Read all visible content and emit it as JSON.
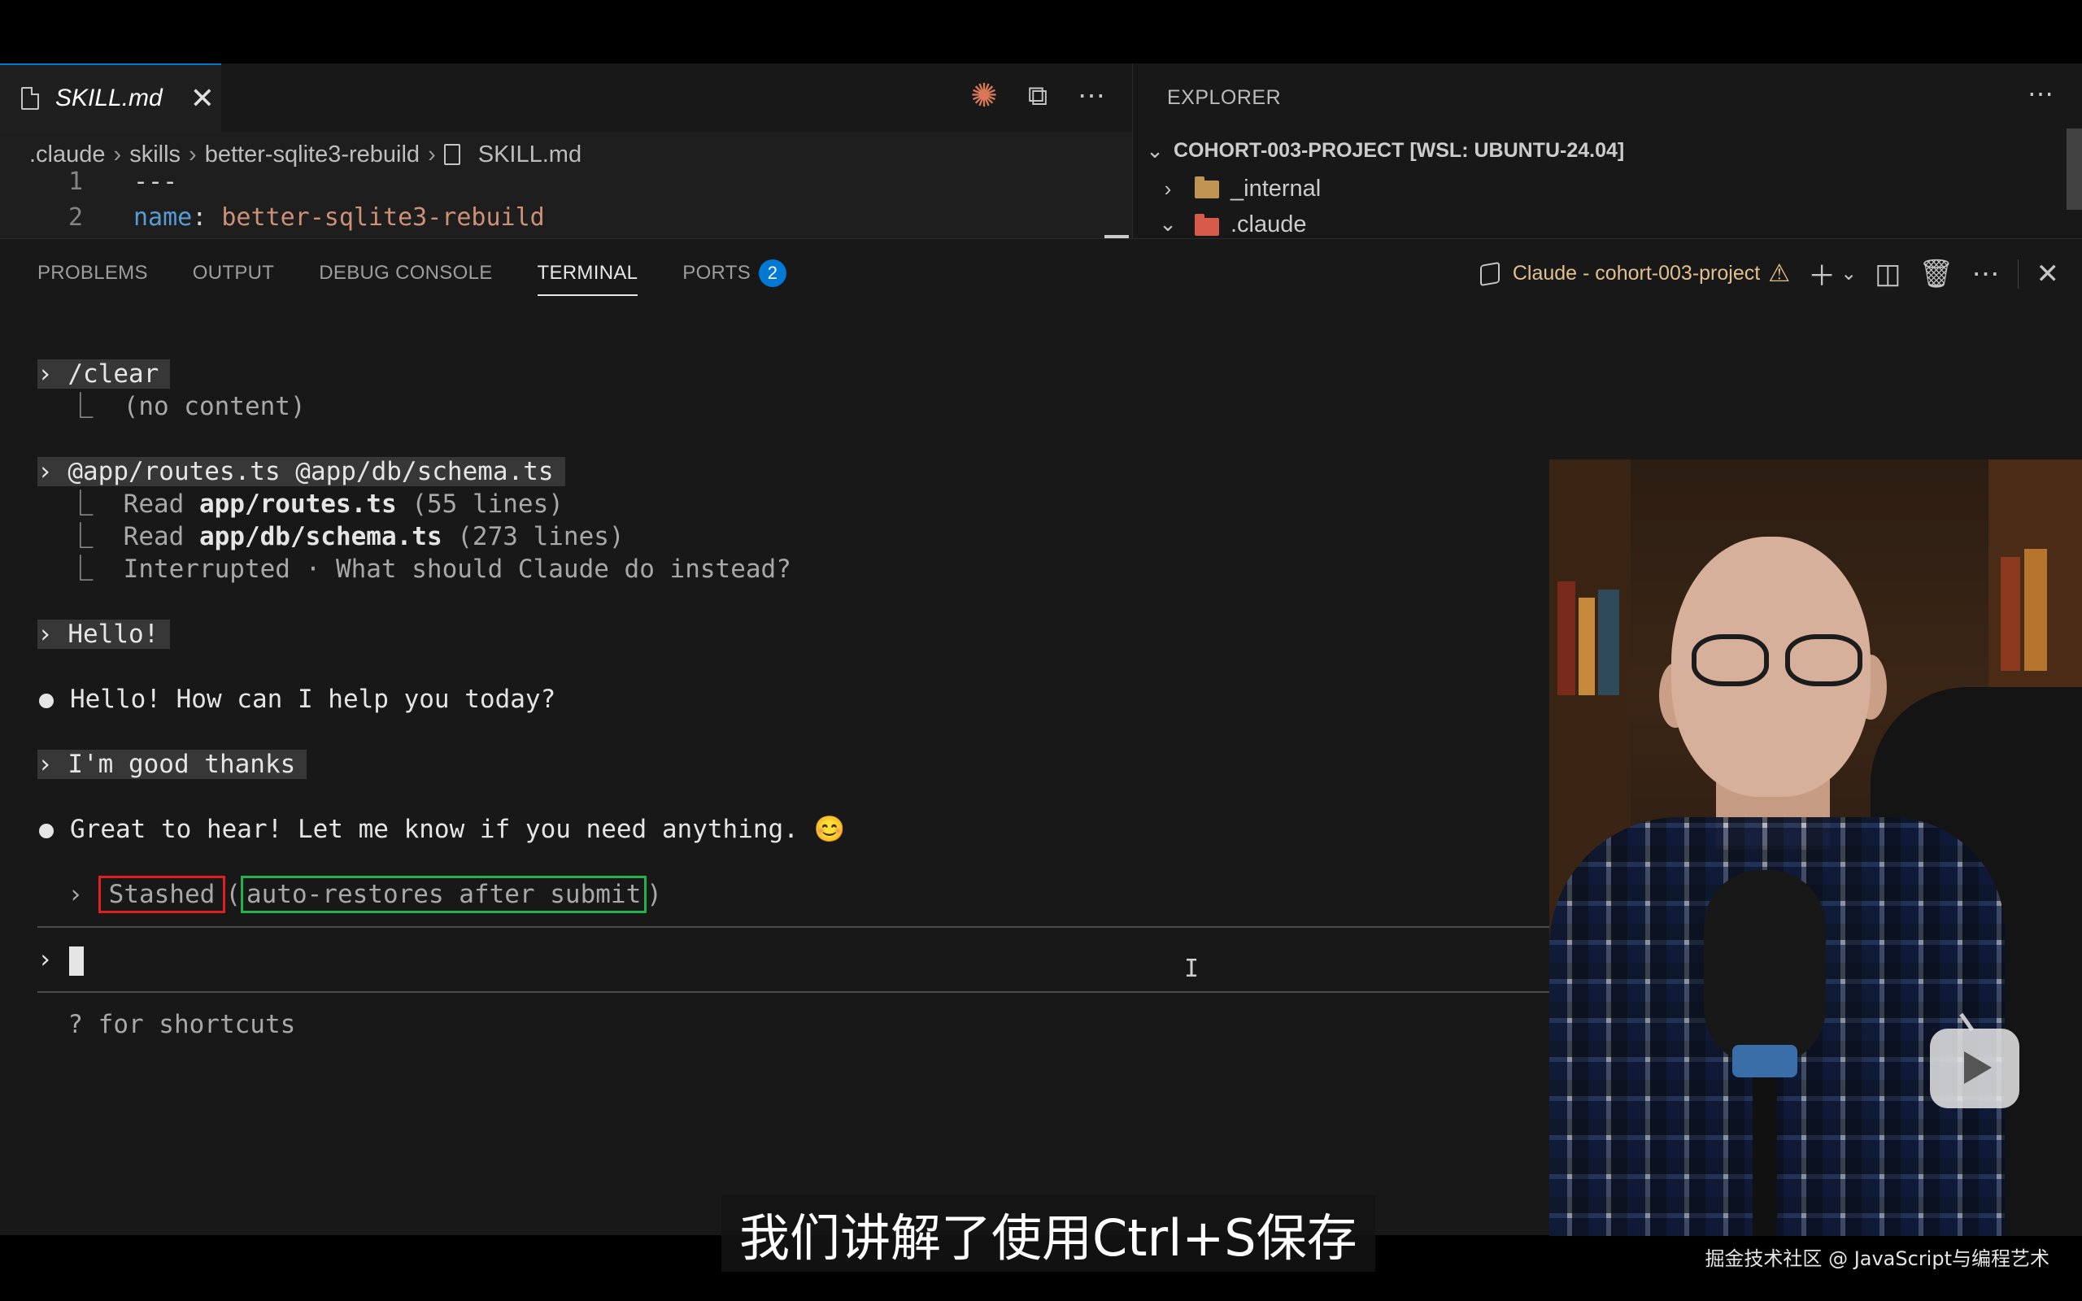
{
  "editor": {
    "tab_label": "SKILL.md",
    "tab_close": "✕",
    "breadcrumb": [
      ".claude",
      "skills",
      "better-sqlite3-rebuild",
      "SKILL.md"
    ],
    "lines": [
      {
        "num": "1",
        "text": "---"
      },
      {
        "num": "2",
        "key": "name",
        "colon": ": ",
        "value": "better-sqlite3-rebuild"
      }
    ]
  },
  "explorer": {
    "title": "EXPLORER",
    "root": "COHORT-003-PROJECT [WSL: UBUNTU-24.04]",
    "items": [
      {
        "label": "_internal",
        "expanded": false
      },
      {
        "label": ".claude",
        "expanded": true
      }
    ]
  },
  "panel": {
    "tabs": [
      {
        "label": "PROBLEMS"
      },
      {
        "label": "OUTPUT"
      },
      {
        "label": "DEBUG CONSOLE"
      },
      {
        "label": "TERMINAL",
        "active": true
      },
      {
        "label": "PORTS",
        "badge": "2"
      }
    ],
    "terminal_name": "Claude - cohort-003-project"
  },
  "terminal": {
    "cmd1": "/clear",
    "cmd1_out": "(no content)",
    "cmd2": "@app/routes.ts @app/db/schema.ts",
    "read1_prefix": "Read ",
    "read1_file": "app/routes.ts",
    "read1_suffix": " (55 lines)",
    "read2_prefix": "Read ",
    "read2_file": "app/db/schema.ts",
    "read2_suffix": " (273 lines)",
    "interrupted": "Interrupted · What should Claude do instead?",
    "cmd3": "Hello!",
    "reply3": "Hello! How can I help you today?",
    "cmd4": "I'm good thanks",
    "reply4": "Great to hear! Let me know if you need anything. 😊",
    "stashed": "Stashed",
    "stash_note": "auto-restores after submit",
    "hint": "? for shortcuts"
  },
  "overlay": {
    "subtitle": "我们讲解了使用Ctrl+S保存",
    "watermark": "掘金技术社区 @ JavaScript与编程艺术"
  },
  "colors": {
    "accent": "#0078d4",
    "stash_highlight": "#e02020",
    "restore_highlight": "#22b24a",
    "warning": "#e2c08d"
  }
}
